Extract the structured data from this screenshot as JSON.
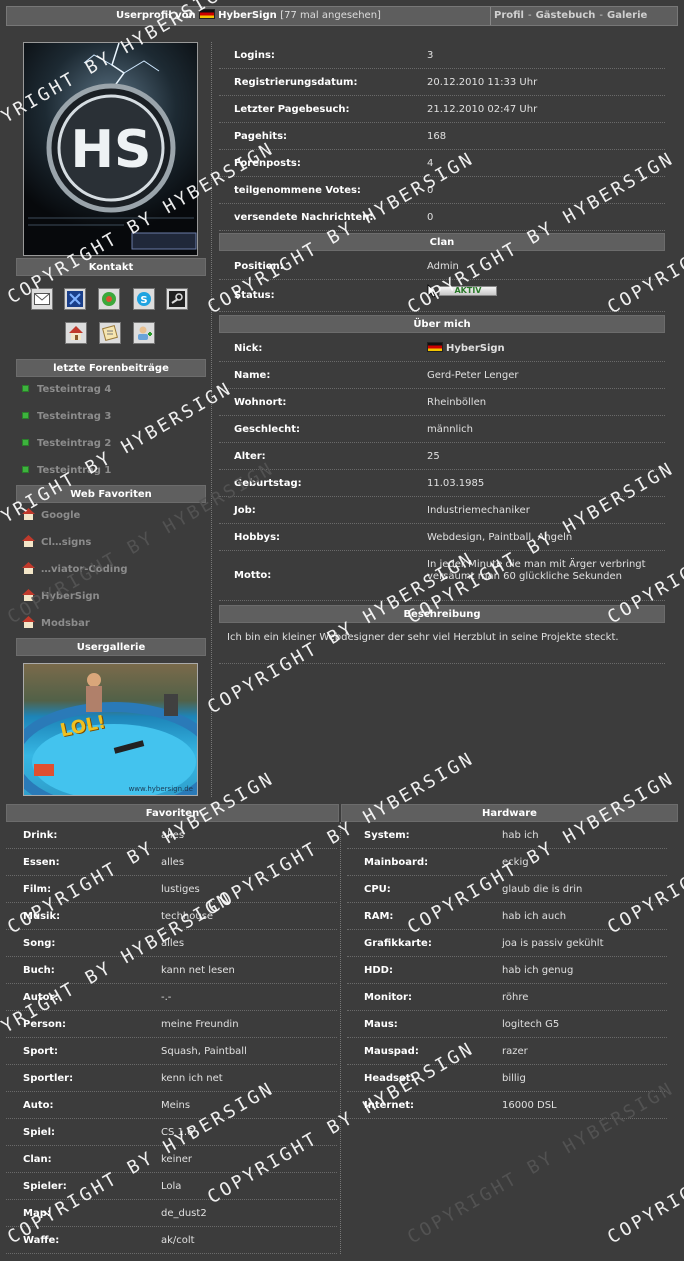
{
  "header": {
    "title_prefix": "Userprofil von",
    "username": "HyberSign",
    "views": "[77 mal angesehen]",
    "links": [
      "Profil",
      "Gästebuch",
      "Galerie"
    ],
    "separator": "-"
  },
  "sidebar": {
    "contact_title": "Kontakt",
    "contact_icons": [
      "mail-icon",
      "msn-icon",
      "icq-icon",
      "skype-icon",
      "steam-icon",
      "homepage-icon",
      "guestbook-icon",
      "add-friend-icon"
    ],
    "posts_title": "letzte Forenbeiträge",
    "posts": [
      "Testeintrag 4",
      "Testeintrag 3",
      "Testeintrag 2",
      "Testeintrag 1"
    ],
    "favorites_title": "Web Favoriten",
    "web_favorites": [
      "Google",
      "Cl…signs",
      "…viator-Coding",
      "HyberSign",
      "Modsbar"
    ],
    "gallery_title": "Usergallerie",
    "gallery_caption": "LOL!",
    "gallery_footer": "www.hybersign.de"
  },
  "stats": [
    {
      "label": "Logins:",
      "value": "3"
    },
    {
      "label": "Registrierungsdatum:",
      "value": "20.12.2010 11:33 Uhr"
    },
    {
      "label": "Letzter Pagebesuch:",
      "value": "21.12.2010 02:47 Uhr"
    },
    {
      "label": "Pagehits:",
      "value": "168"
    },
    {
      "label": "Forenposts:",
      "value": "4"
    },
    {
      "label": "teilgenommene Votes:",
      "value": "0"
    },
    {
      "label": "versendete Nachrichten:",
      "value": "0"
    }
  ],
  "clan": {
    "title": "Clan",
    "position_label": "Position:",
    "position_value": "Admin",
    "status_label": "Status:",
    "status_value": "AKTIV"
  },
  "about": {
    "title": "Über mich",
    "rows": [
      {
        "label": "Nick:",
        "value": "HyberSign"
      },
      {
        "label": "Name:",
        "value": "Gerd-Peter Lenger"
      },
      {
        "label": "Wohnort:",
        "value": "Rheinböllen"
      },
      {
        "label": "Geschlecht:",
        "value": "männlich"
      },
      {
        "label": "Alter:",
        "value": "25"
      },
      {
        "label": "Geburtstag:",
        "value": "11.03.1985"
      },
      {
        "label": "Job:",
        "value": "Industriemechaniker"
      },
      {
        "label": "Hobbys:",
        "value": "Webdesign, Paintball, Angeln"
      }
    ],
    "motto_label": "Motto:",
    "motto_value": "In jeder Minute die man mit Ärger verbringt versäumt man 60 glückliche Sekunden"
  },
  "description": {
    "title": "Beschreibung",
    "text": "Ich bin ein kleiner Webdesigner der sehr viel Herzblut in seine Projekte steckt."
  },
  "favorites": {
    "title": "Favoriten",
    "rows": [
      {
        "label": "Drink:",
        "value": "alles"
      },
      {
        "label": "Essen:",
        "value": "alles"
      },
      {
        "label": "Film:",
        "value": "lustiges"
      },
      {
        "label": "Musik:",
        "value": "techhouse"
      },
      {
        "label": "Song:",
        "value": "alles"
      },
      {
        "label": "Buch:",
        "value": "kann net lesen"
      },
      {
        "label": "Autor:",
        "value": "-.-"
      },
      {
        "label": "Person:",
        "value": "meine Freundin"
      },
      {
        "label": "Sport:",
        "value": "Squash, Paintball"
      },
      {
        "label": "Sportler:",
        "value": "kenn ich net"
      },
      {
        "label": "Auto:",
        "value": "Meins"
      },
      {
        "label": "Spiel:",
        "value": "CS 1.6"
      },
      {
        "label": "Clan:",
        "value": "keiner"
      },
      {
        "label": "Spieler:",
        "value": "Lola"
      },
      {
        "label": "Map:",
        "value": "de_dust2"
      },
      {
        "label": "Waffe:",
        "value": "ak/colt"
      }
    ]
  },
  "hardware": {
    "title": "Hardware",
    "rows": [
      {
        "label": "System:",
        "value": "hab ich"
      },
      {
        "label": "Mainboard:",
        "value": "eckig"
      },
      {
        "label": "CPU:",
        "value": "glaub die is drin"
      },
      {
        "label": "RAM:",
        "value": "hab ich auch"
      },
      {
        "label": "Grafikkarte:",
        "value": "joa is passiv gekühlt"
      },
      {
        "label": "HDD:",
        "value": "hab ich genug"
      },
      {
        "label": "Monitor:",
        "value": "röhre"
      },
      {
        "label": "Maus:",
        "value": "logitech G5"
      },
      {
        "label": "Mauspad:",
        "value": "razer"
      },
      {
        "label": "Headset:",
        "value": "billig"
      },
      {
        "label": "Internet:",
        "value": "16000 DSL"
      }
    ]
  },
  "watermark_text": "COPYRIGHT BY HYBERSIGN"
}
